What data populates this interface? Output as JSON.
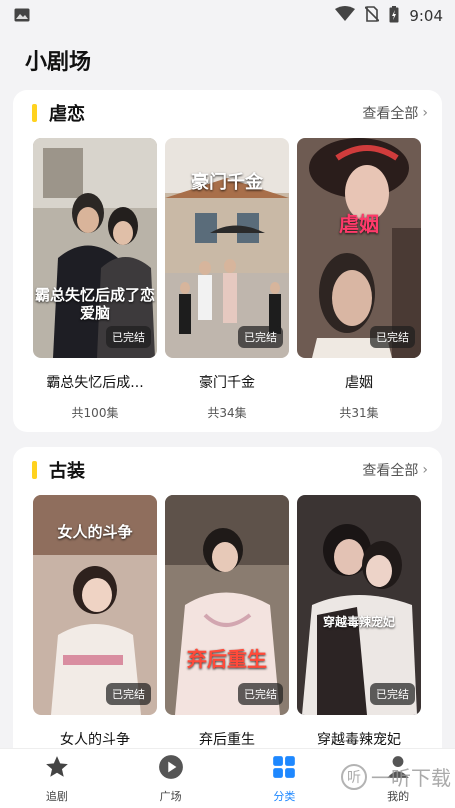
{
  "status_bar": {
    "time": "9:04",
    "icons": [
      "image-icon",
      "wifi-icon",
      "no-sim-icon",
      "battery-charging-icon"
    ]
  },
  "page": {
    "title": "小剧场"
  },
  "sections": [
    {
      "title": "虐恋",
      "see_all": "查看全部",
      "accent_color": "#ffd21f",
      "items": [
        {
          "title": "霸总失忆后成...",
          "count": "共100集",
          "badge": "已完结",
          "poster_text": "霸总失忆后成了恋爱脑"
        },
        {
          "title": "豪门千金",
          "count": "共34集",
          "badge": "已完结",
          "poster_text": "豪门千金"
        },
        {
          "title": "虐姻",
          "count": "共31集",
          "badge": "已完结",
          "poster_text": "虐姻"
        }
      ]
    },
    {
      "title": "古装",
      "see_all": "查看全部",
      "accent_color": "#ffd21f",
      "items": [
        {
          "title": "女人的斗争",
          "badge": "已完结",
          "poster_text": "女人的斗争"
        },
        {
          "title": "弃后重生",
          "badge": "已完结",
          "poster_text": "弃后重生"
        },
        {
          "title": "穿越毒辣宠妃",
          "badge": "已完结",
          "poster_text": "穿越毒辣宠妃"
        }
      ]
    }
  ],
  "tabbar": {
    "active_color": "#1e88ff",
    "tabs": [
      {
        "label": "追剧",
        "icon": "star-icon"
      },
      {
        "label": "广场",
        "icon": "play-icon"
      },
      {
        "label": "分类",
        "icon": "grid-icon"
      },
      {
        "label": "我的",
        "icon": "person-icon"
      }
    ]
  },
  "watermark": {
    "logo": "听",
    "text": "一听下载"
  }
}
